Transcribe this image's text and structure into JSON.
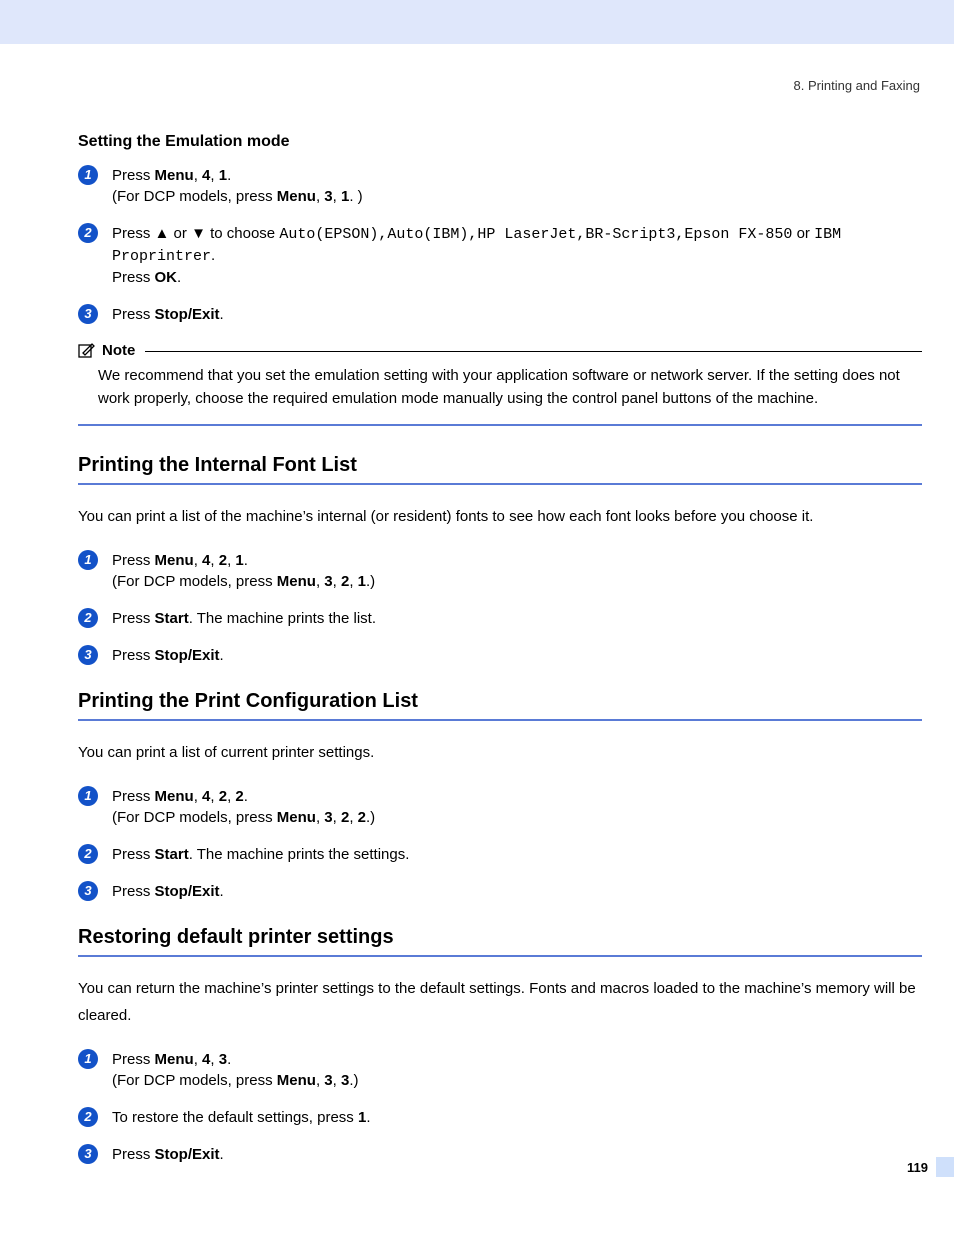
{
  "chapter": "8. Printing and Faxing",
  "emulation": {
    "heading": "Setting the Emulation mode",
    "step1_a": "Press ",
    "step1_b": "Menu",
    "step1_c": ", ",
    "step1_d": "4",
    "step1_e": ", ",
    "step1_f": "1",
    "step1_g": ". ",
    "step1_sub_a": "(For DCP models, press ",
    "step1_sub_b": "Menu",
    "step1_sub_c": ", ",
    "step1_sub_d": "3",
    "step1_sub_e": ", ",
    "step1_sub_f": "1",
    "step1_sub_g": ". )",
    "step2_a": "Press ",
    "step2_b": " or ",
    "step2_c": " to choose ",
    "step2_opts": "Auto(EPSON),Auto(IBM),HP LaserJet,BR-Script3,Epson FX-850",
    "step2_d": " or ",
    "step2_opts2": "IBM Proprintrer",
    "step2_e": ".",
    "step2_f": "Press ",
    "step2_g": "OK",
    "step2_h": ".",
    "step3_a": "Press ",
    "step3_b": "Stop/Exit",
    "step3_c": ".",
    "note_label": "Note",
    "note_body": "We recommend that you set the emulation setting with your application software or network server. If the setting does not work properly, choose the required emulation mode manually using the control panel buttons of the machine."
  },
  "fontlist": {
    "heading": "Printing the Internal Font List",
    "intro": "You can print a list of the machine’s internal (or resident) fonts to see how each font looks before you choose it.",
    "s1a": "Press ",
    "s1b": "Menu",
    "s1c": ", ",
    "s1d": "4",
    "s1e": ", ",
    "s1f": "2",
    "s1g": ", ",
    "s1h": "1",
    "s1i": ".",
    "s1sub_a": "(For DCP models, press ",
    "s1sub_b": "Menu",
    "s1sub_c": ", ",
    "s1sub_d": "3",
    "s1sub_e": ", ",
    "s1sub_f": "2",
    "s1sub_g": ", ",
    "s1sub_h": "1",
    "s1sub_i": ".)",
    "s2a": "Press ",
    "s2b": "Start",
    "s2c": ". The machine prints the list.",
    "s3a": "Press ",
    "s3b": "Stop/Exit",
    "s3c": "."
  },
  "config": {
    "heading": "Printing the Print Configuration List",
    "intro": "You can print a list of current printer settings.",
    "s1a": "Press ",
    "s1b": "Menu",
    "s1c": ", ",
    "s1d": "4",
    "s1e": ", ",
    "s1f": "2",
    "s1g": ", ",
    "s1h": "2",
    "s1i": ".",
    "s1sub_a": "(For DCP models, press ",
    "s1sub_b": "Menu",
    "s1sub_c": ", ",
    "s1sub_d": "3",
    "s1sub_e": ", ",
    "s1sub_f": "2",
    "s1sub_g": ", ",
    "s1sub_h": "2",
    "s1sub_i": ".)",
    "s2a": "Press ",
    "s2b": "Start",
    "s2c": ". The machine prints the settings.",
    "s3a": "Press ",
    "s3b": "Stop/Exit",
    "s3c": "."
  },
  "restore": {
    "heading": "Restoring default printer settings",
    "intro": "You can return the machine’s printer settings to the default settings. Fonts and macros loaded to the machine’s memory will be cleared.",
    "s1a": "Press ",
    "s1b": "Menu",
    "s1c": ", ",
    "s1d": "4",
    "s1e": ", ",
    "s1f": "3",
    "s1g": ".",
    "s1sub_a": "(For DCP models, press ",
    "s1sub_b": "Menu",
    "s1sub_c": ", ",
    "s1sub_d": "3",
    "s1sub_e": ", ",
    "s1sub_f": "3",
    "s1sub_g": ".)",
    "s2a": "To restore the default settings, press ",
    "s2b": "1",
    "s2c": ".",
    "s3a": "Press ",
    "s3b": "Stop/Exit",
    "s3c": "."
  },
  "badges": {
    "n1": "1",
    "n2": "2",
    "n3": "3"
  },
  "arrows": {
    "up": "▲",
    "down": "▼"
  },
  "pagenum": "119"
}
